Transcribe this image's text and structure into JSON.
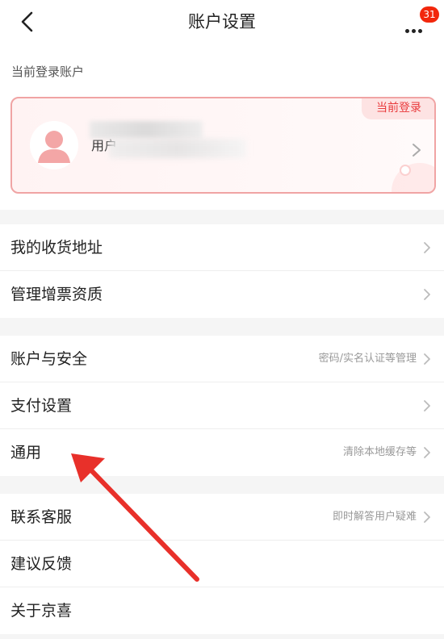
{
  "header": {
    "title": "账户设置",
    "badge_count": "31",
    "back_icon": "chevron-left-icon",
    "more_icon": "more-dots-icon"
  },
  "account": {
    "section_label": "当前登录账户",
    "current_tag": "当前登录",
    "username_visible": "用户",
    "avatar_icon": "user-avatar-icon"
  },
  "groups": [
    {
      "rows": [
        {
          "label": "我的收货地址",
          "hint": ""
        },
        {
          "label": "管理增票资质",
          "hint": ""
        }
      ]
    },
    {
      "rows": [
        {
          "label": "账户与安全",
          "hint": "密码/实名认证等管理"
        },
        {
          "label": "支付设置",
          "hint": ""
        },
        {
          "label": "通用",
          "hint": "清除本地缓存等"
        }
      ]
    },
    {
      "rows": [
        {
          "label": "联系客服",
          "hint": "即时解答用户疑难"
        },
        {
          "label": "建议反馈",
          "hint": ""
        },
        {
          "label": "关于京喜",
          "hint": ""
        }
      ]
    }
  ],
  "colors": {
    "accent": "#e93b3d",
    "badge": "#f2270c",
    "card_border": "#f0a4a4",
    "annotation_arrow": "#e8302a"
  }
}
